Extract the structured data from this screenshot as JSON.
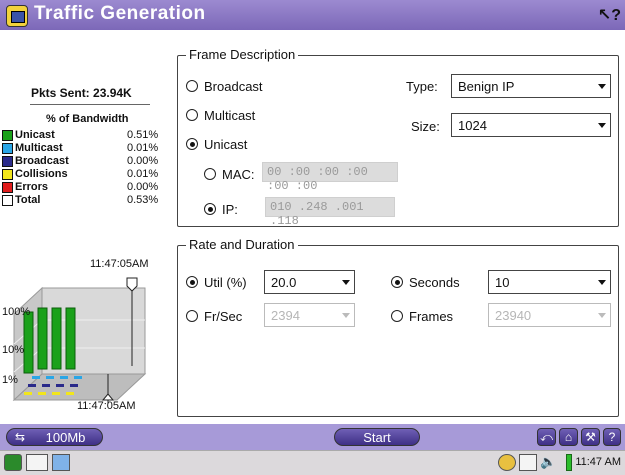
{
  "title": "Traffic Generation",
  "help_icon": "help-cursor-icon",
  "stats": {
    "pkts_sent": "Pkts Sent: 23.94K",
    "bw_header": "% of Bandwidth",
    "rows": [
      {
        "label": "Unicast",
        "value": "0.51%",
        "color": "#1aa11a"
      },
      {
        "label": "Multicast",
        "value": "0.01%",
        "color": "#2aa6e6"
      },
      {
        "label": "Broadcast",
        "value": "0.00%",
        "color": "#2a2a8a"
      },
      {
        "label": "Collisions",
        "value": "0.01%",
        "color": "#f2e61c"
      },
      {
        "label": "Errors",
        "value": "0.00%",
        "color": "#e01c1c"
      },
      {
        "label": "Total",
        "value": "0.53%",
        "color": "#ffffff"
      }
    ]
  },
  "chart": {
    "time_top": "11:47:05AM",
    "time_bottom": "11:47:05AM",
    "y_labels": [
      "100%",
      "10%",
      "1%"
    ]
  },
  "frame": {
    "legend": "Frame Description",
    "broadcast": "Broadcast",
    "multicast": "Multicast",
    "unicast": "Unicast",
    "selected": "Unicast",
    "type_label": "Type:",
    "type_value": "Benign IP",
    "size_label": "Size:",
    "size_value": "1024",
    "mac_label": "MAC:",
    "mac_value": "00 :00 :00 :00 :00 :00",
    "ip_label": "IP:",
    "ip_value": "010 .248 .001 .118",
    "addr_selected": "IP"
  },
  "rate": {
    "legend": "Rate and Duration",
    "util_label": "Util (%)",
    "util_value": "20.0",
    "frsec_label": "Fr/Sec",
    "frsec_value": "2394",
    "seconds_label": "Seconds",
    "seconds_value": "10",
    "frames_label": "Frames",
    "frames_value": "23940"
  },
  "bottom": {
    "speed": "100Mb",
    "start": "Start",
    "accent": "#4a3a96"
  },
  "taskbar": {
    "clock": "11:47 AM"
  }
}
